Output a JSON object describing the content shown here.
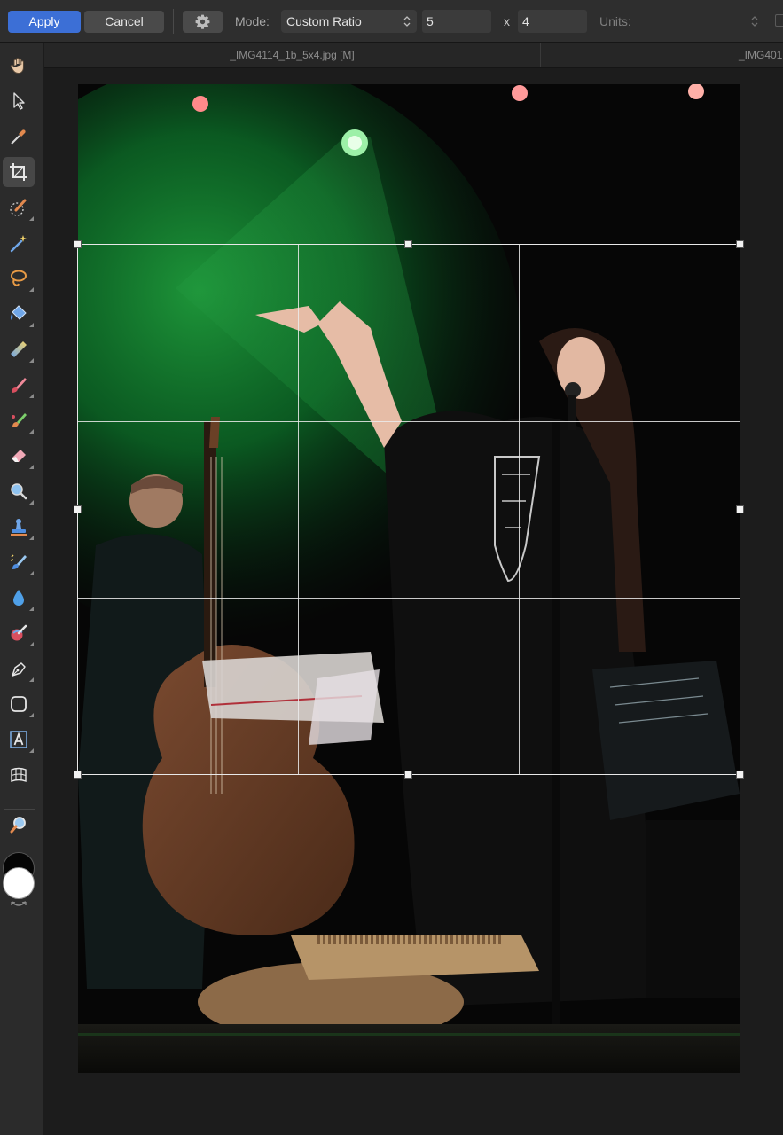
{
  "toolbar": {
    "apply_label": "Apply",
    "cancel_label": "Cancel",
    "settings_icon": "gear-icon",
    "mode_label": "Mode:",
    "mode_value": "Custom Ratio",
    "width_value": "5",
    "separator_label": "x",
    "height_value": "4",
    "units_label": "Units:"
  },
  "tabs": [
    {
      "label": "_IMG4114_1b_5x4.jpg [M]"
    },
    {
      "label": "_IMG401"
    }
  ],
  "tools": [
    {
      "name": "view-tool",
      "icon": "hand-icon"
    },
    {
      "name": "move-tool",
      "icon": "arrow-pointer-icon"
    },
    {
      "name": "color-picker-tool",
      "icon": "eyedropper-icon"
    },
    {
      "name": "crop-tool",
      "icon": "crop-icon",
      "active": true
    },
    {
      "name": "selection-brush-tool",
      "icon": "selection-brush-icon"
    },
    {
      "name": "flood-select-tool",
      "icon": "magic-wand-icon"
    },
    {
      "name": "freehand-selection-tool",
      "icon": "lasso-icon"
    },
    {
      "name": "flood-fill-tool",
      "icon": "paint-bucket-icon"
    },
    {
      "name": "gradient-tool",
      "icon": "gradient-icon"
    },
    {
      "name": "paint-brush-tool",
      "icon": "paint-brush-icon"
    },
    {
      "name": "color-replacement-tool",
      "icon": "color-replacement-icon"
    },
    {
      "name": "erase-brush-tool",
      "icon": "eraser-icon"
    },
    {
      "name": "dodge-brush-tool",
      "icon": "dodge-icon"
    },
    {
      "name": "clone-brush-tool",
      "icon": "clone-stamp-icon"
    },
    {
      "name": "inpainting-brush-tool",
      "icon": "inpainting-icon"
    },
    {
      "name": "blur-brush-tool",
      "icon": "drop-icon"
    },
    {
      "name": "smudge-brush-tool",
      "icon": "smudge-icon"
    },
    {
      "name": "pen-tool",
      "icon": "pen-nib-icon"
    },
    {
      "name": "shape-tool",
      "icon": "rounded-rectangle-icon"
    },
    {
      "name": "text-tool",
      "icon": "text-frame-icon"
    },
    {
      "name": "mesh-warp-tool",
      "icon": "mesh-warp-icon"
    },
    {
      "name": "zoom-tool",
      "icon": "magnifier-icon"
    }
  ],
  "colors": {
    "accent": "#3c6fd6",
    "primary_color": "#ffffff",
    "secondary_color": "#050505"
  },
  "crop": {
    "grid": "rule of thirds",
    "ratio": "5 x 4"
  }
}
